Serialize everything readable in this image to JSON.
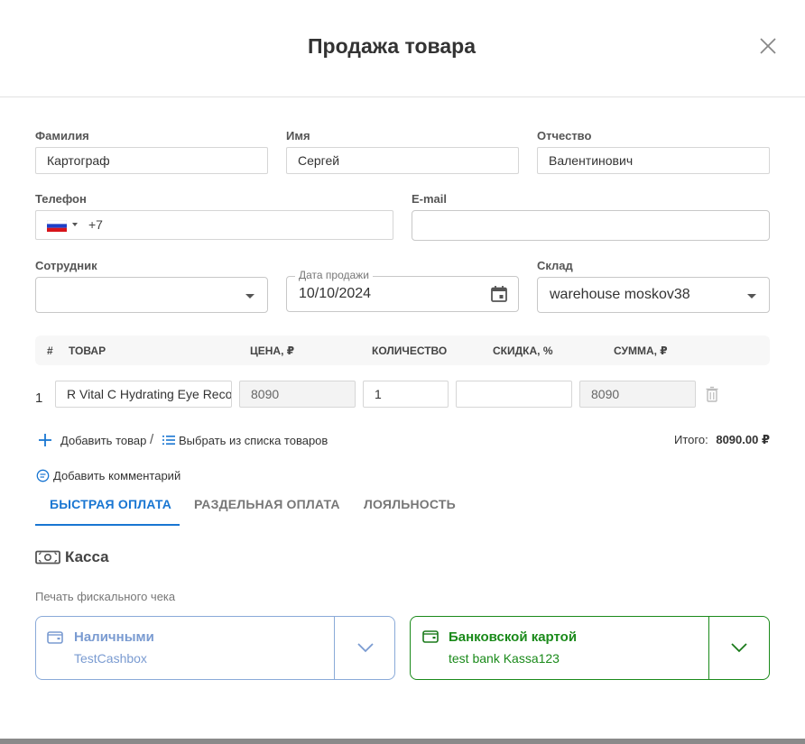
{
  "modal": {
    "title": "Продажа товара"
  },
  "form": {
    "last_name": {
      "label": "Фамилия",
      "value": "Картограф"
    },
    "first_name": {
      "label": "Имя",
      "value": "Сергей"
    },
    "middle_name": {
      "label": "Отчество",
      "value": "Валентинович"
    },
    "phone": {
      "label": "Телефон",
      "value": "+7"
    },
    "email": {
      "label": "E-mail",
      "value": ""
    },
    "employee": {
      "label": "Сотрудник",
      "value": ""
    },
    "sale_date": {
      "label": "Дата продажи",
      "value": "10/10/2024"
    },
    "warehouse": {
      "label": "Склад",
      "value": "warehouse moskov38"
    }
  },
  "table": {
    "headers": {
      "num": "#",
      "product": "Товар",
      "price": "Цена, ₽",
      "qty": "Количество",
      "discount": "Скидка, %",
      "sum": "Сумма, ₽"
    },
    "rows": [
      {
        "num": "1",
        "product": "R Vital C Hydrating Eye Recovery",
        "price": "8090",
        "qty": "1",
        "discount": "",
        "sum": "8090"
      }
    ]
  },
  "actions": {
    "add_product": "Добавить товар",
    "separator": "/",
    "choose_from_list": "Выбрать из списка товаров",
    "total_label": "Итого:",
    "total_value": "8090.00 ₽",
    "add_comment": "Добавить комментарий"
  },
  "tabs": [
    {
      "label": "Быстрая оплата",
      "active": true
    },
    {
      "label": "Раздельная оплата",
      "active": false
    },
    {
      "label": "Лояльность",
      "active": false
    }
  ],
  "cashbox": {
    "title": "Касса",
    "fiscal_label": "Печать фискального чека",
    "cash": {
      "title": "Наличными",
      "subtitle": "TestCashbox",
      "color": "#7a9bd1"
    },
    "card": {
      "title": "Банковской картой",
      "subtitle": "test bank Kassa123",
      "color": "#1a8a1a"
    }
  },
  "colors": {
    "accent": "#1976d2",
    "active_tab": "#1976d2"
  }
}
